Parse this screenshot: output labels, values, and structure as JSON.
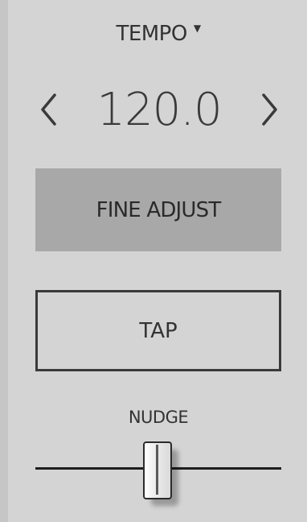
{
  "tempo": {
    "label": "TEMPO",
    "dropdown_caret": "▼",
    "value": "120.0",
    "decrement_icon": "chevron-left-icon",
    "increment_icon": "chevron-right-icon"
  },
  "buttons": {
    "fine_adjust_label": "FINE ADJUST",
    "tap_label": "TAP"
  },
  "nudge": {
    "label": "NUDGE",
    "position_fraction": 0.5
  },
  "colors": {
    "background": "#d4d4d4",
    "fine_adjust_bg": "#a8a8a8",
    "text": "#333333",
    "track": "#1e1e1e"
  }
}
